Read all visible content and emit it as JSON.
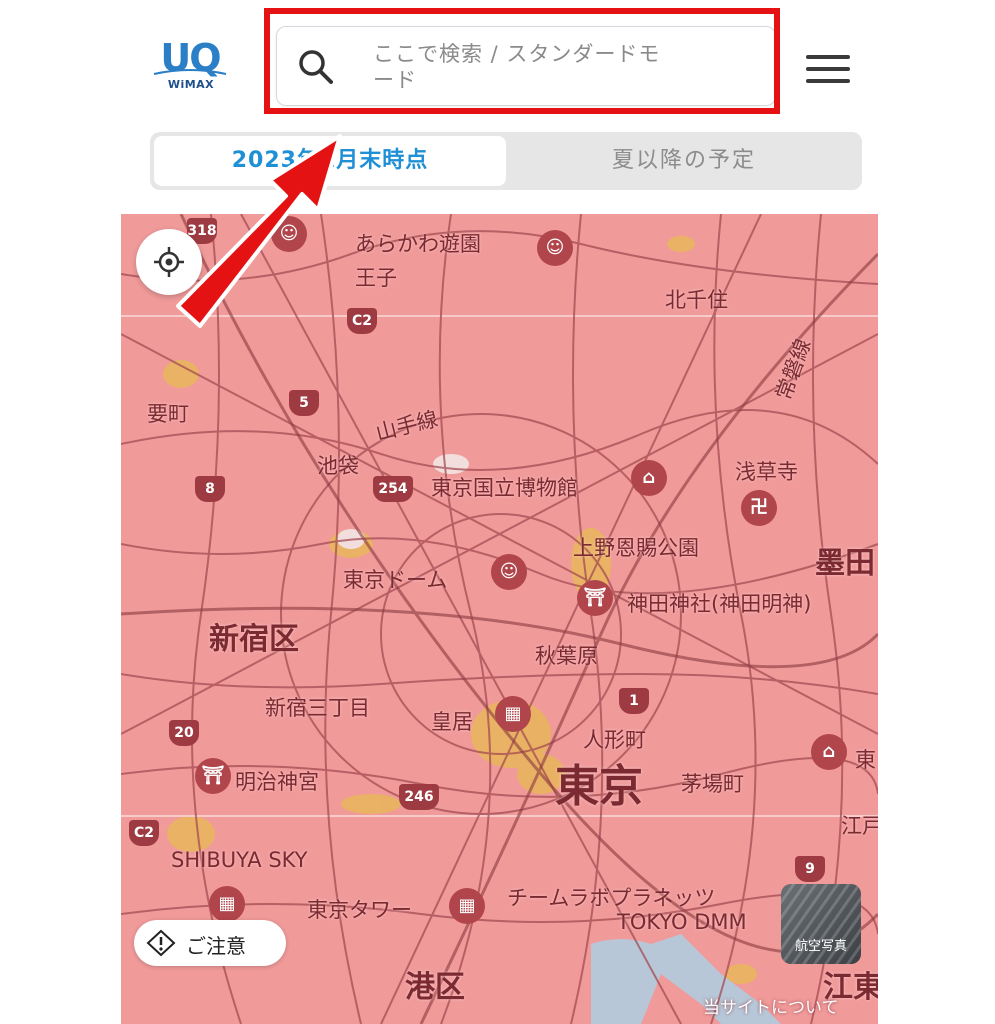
{
  "header": {
    "logo": {
      "brand": "UQ",
      "sub": "WiMAX"
    },
    "search": {
      "icon": "search-icon",
      "placeholder": "ここで検索 / スタンダードモード"
    },
    "menu_icon": "hamburger-menu-icon",
    "highlight_color": "#e41212"
  },
  "tabs": [
    {
      "label": "2023年1月末時点",
      "active": true
    },
    {
      "label": "夏以降の予定",
      "active": false
    }
  ],
  "map": {
    "coverage_color": "#f09a9a",
    "labels": {
      "arakawa_yuen": "あらかわ遊園",
      "oji": "王子",
      "kitasenju": "北千住",
      "kanamecho": "要町",
      "yamanote": "山手線",
      "ikebukuro": "池袋",
      "tokyo_museum": "東京国立博物館",
      "asakusa": "浅草寺",
      "joban": "常磐線",
      "ueno_park": "上野恩賜公園",
      "sumida": "墨田",
      "tokyo_dome": "東京ドーム",
      "kanda": "神田神社(神田明神)",
      "shinjuku_ku": "新宿区",
      "akihabara": "秋葉原",
      "shinjuku_3": "新宿三丁目",
      "kokyo": "皇居",
      "ningyocho": "人形町",
      "meiji": "明治神宮",
      "tokyo": "東京",
      "kayabacho": "茅場町",
      "shibuya_sky": "SHIBUYA SKY",
      "tokyo_tower": "東京タワー",
      "teamlab": "チームラボプラネッツ",
      "tokyo_dmm": "TOKYO DMM",
      "minato_ku": "港区",
      "koto": "江東",
      "edo": "江戸",
      "higashi": "東"
    },
    "shields": [
      "318",
      "C2",
      "5",
      "254",
      "8",
      "1",
      "20",
      "246",
      "C2",
      "9"
    ]
  },
  "controls": {
    "locate_icon": "crosshair-icon",
    "caution_label": "ご注意",
    "caution_icon": "warning-icon",
    "aerial_label": "航空写真",
    "about_link": "当サイトについて"
  },
  "annotation": {
    "arrow_color": "#e41212"
  }
}
